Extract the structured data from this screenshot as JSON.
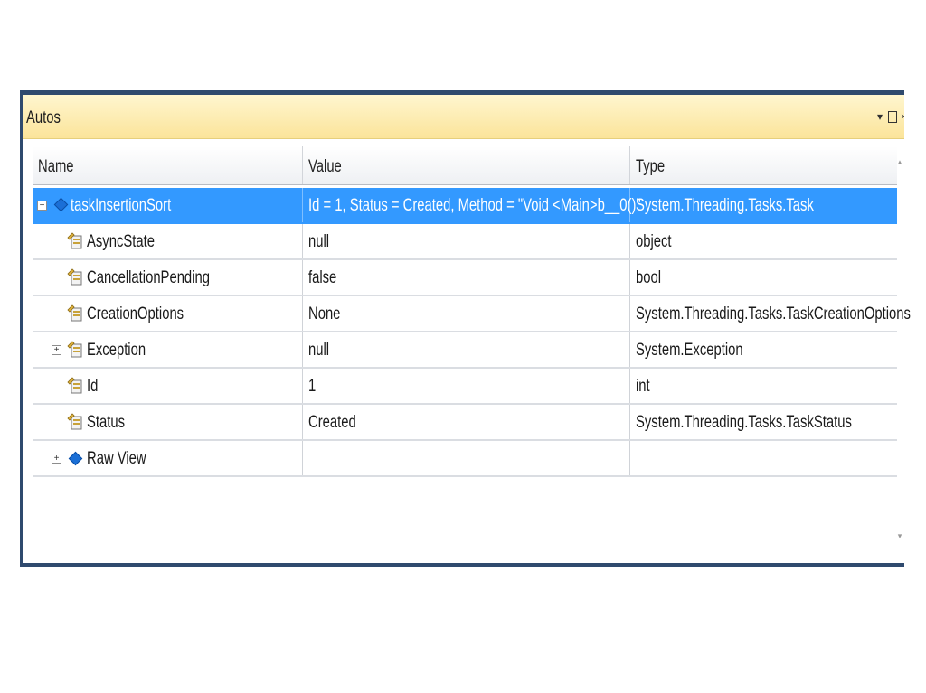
{
  "window": {
    "title": "Autos",
    "dropdown_glyph": "▾",
    "close_glyph": "×"
  },
  "columns": {
    "name": "Name",
    "value": "Value",
    "type": "Type"
  },
  "rows": [
    {
      "name": "taskInsertionSort",
      "value": "Id = 1, Status = Created, Method = \"Void <Main>b__0()\"",
      "type": "System.Threading.Tasks.Task",
      "expander": "−",
      "icon": "object-diamond-icon",
      "selected": true
    },
    {
      "name": "AsyncState",
      "value": "null",
      "type": "object",
      "icon": "property-icon"
    },
    {
      "name": "CancellationPending",
      "value": "false",
      "type": "bool",
      "icon": "property-icon"
    },
    {
      "name": "CreationOptions",
      "value": "None",
      "type": "System.Threading.Tasks.TaskCreationOptions",
      "icon": "property-icon"
    },
    {
      "name": "Exception",
      "value": "null",
      "type": "System.Exception",
      "expander": "+",
      "icon": "property-icon"
    },
    {
      "name": "Id",
      "value": "1",
      "type": "int",
      "icon": "property-icon"
    },
    {
      "name": "Status",
      "value": "Created",
      "type": "System.Threading.Tasks.TaskStatus",
      "icon": "property-icon"
    },
    {
      "name": "Raw View",
      "value": "",
      "type": "",
      "expander": "+",
      "icon": "raw-view-diamond-icon"
    }
  ],
  "colors": {
    "selection": "#3399ff",
    "title_bar": "#fbe49a",
    "frame": "#2f4a6e"
  }
}
